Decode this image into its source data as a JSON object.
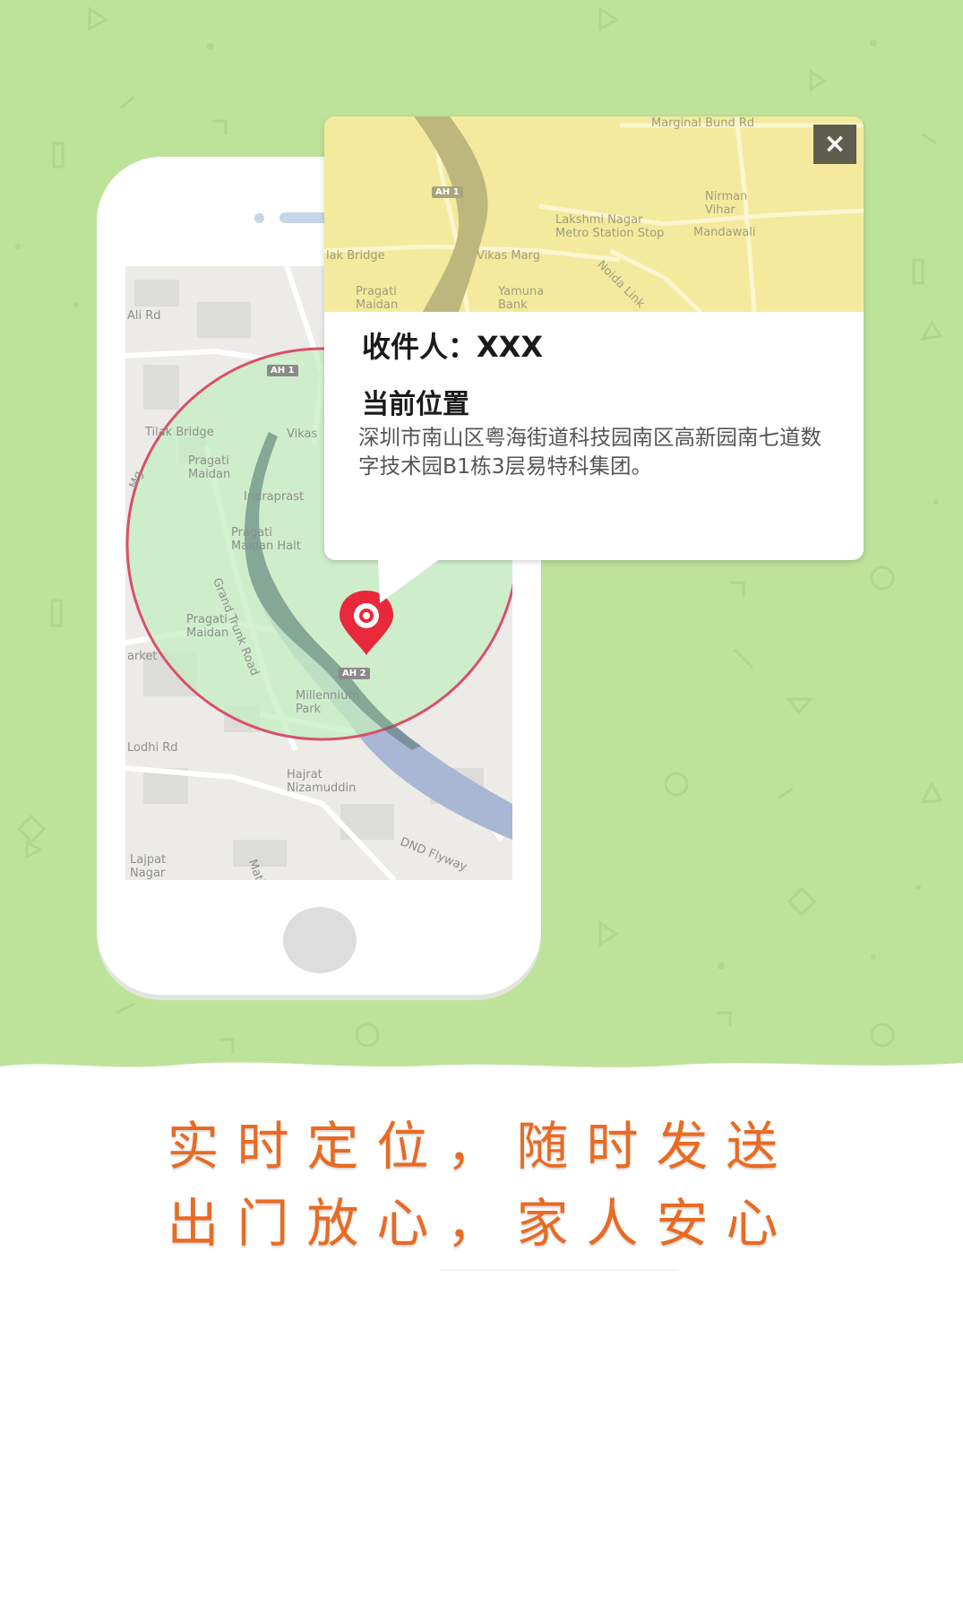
{
  "popup": {
    "close_icon": "×",
    "recipient": "收件人：XXX",
    "location_title": "当前位置",
    "address": "深圳市南山区粤海街道科技园南区高新园南七道数字技术园B1栋3层易特科集团。",
    "map_labels": [
      "Marginal Bund Rd",
      "AH 1",
      "Lakshmi Nagar Metro Station Stop",
      "Nirman Vihar",
      "Mandawali",
      "Vikas Marg",
      "Yamuna Bank",
      "Pragati Maidan",
      "Noida Link",
      "lak Bridge"
    ]
  },
  "phone_map": {
    "labels": [
      "Tilak Bridge",
      "Pragati Maidan",
      "Indraprast",
      "Pragati Maidan Halt",
      "Pragati Maidan",
      "Grand Trunk Road",
      "Millennium Park",
      "Hajrat Nizamuddin",
      "Lodhi Rd",
      "Lajpat Nagar",
      "DND Flyway",
      "Vikas",
      "Mathura",
      "arket",
      "Mg",
      "Ali Rd"
    ],
    "badges": [
      "AH 1",
      "AH 2"
    ]
  },
  "slogan": {
    "line1": "实时定位，随时发送",
    "line2": "出门放心，家人安心"
  },
  "colors": {
    "background_green": "#bde39a",
    "slogan_orange": "#e96b23",
    "pin_red": "#e8283b",
    "radius_fill": "#c4edc0"
  }
}
